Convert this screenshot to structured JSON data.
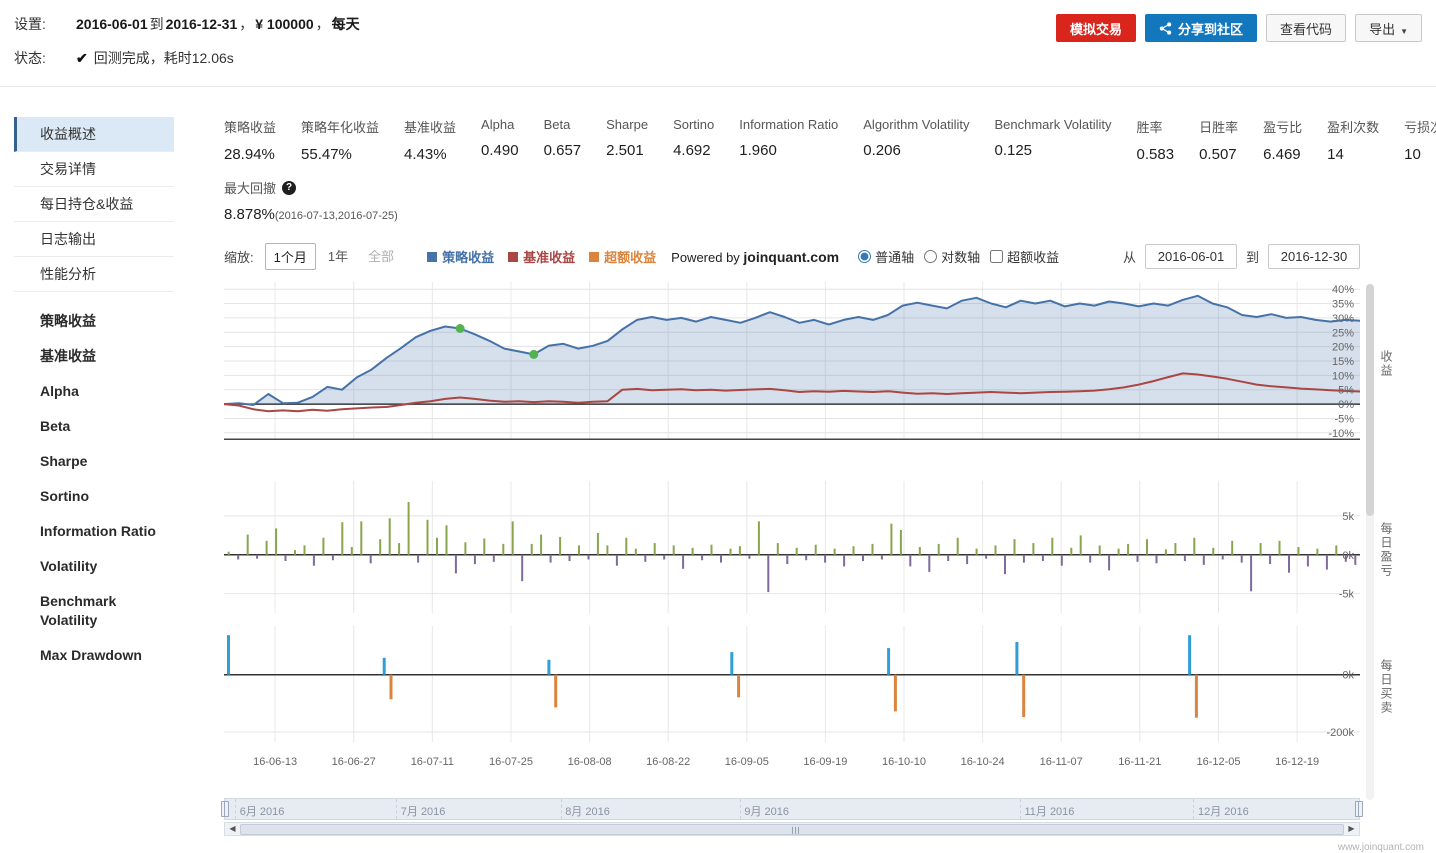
{
  "header": {
    "settings_label": "设置:",
    "settings": {
      "date_from": "2016-06-01",
      "to_word": "到",
      "date_to": "2016-12-31",
      "sep1": "，",
      "capital": "¥ 100000",
      "sep2": "，",
      "frequency": "每天"
    },
    "status_label": "状态:",
    "status_check": "✔",
    "status_text": "回测完成，耗时12.06s",
    "buttons": {
      "simulate": "模拟交易",
      "share": "分享到社区",
      "view_code": "查看代码",
      "export": "导出",
      "export_caret": "▼"
    }
  },
  "sidebar": {
    "nav": [
      {
        "label": "收益概述",
        "active": true
      },
      {
        "label": "交易详情",
        "active": false
      },
      {
        "label": "每日持仓&收益",
        "active": false
      },
      {
        "label": "日志输出",
        "active": false
      },
      {
        "label": "性能分析",
        "active": false
      }
    ],
    "metric_links": [
      "策略收益",
      "基准收益",
      "Alpha",
      "Beta",
      "Sharpe",
      "Sortino",
      "Information Ratio",
      "Volatility",
      "Benchmark Volatility",
      "Max Drawdown"
    ]
  },
  "metrics": [
    {
      "label": "策略收益",
      "value": "28.94%"
    },
    {
      "label": "策略年化收益",
      "value": "55.47%"
    },
    {
      "label": "基准收益",
      "value": "4.43%"
    },
    {
      "label": "Alpha",
      "value": "0.490"
    },
    {
      "label": "Beta",
      "value": "0.657"
    },
    {
      "label": "Sharpe",
      "value": "2.501"
    },
    {
      "label": "Sortino",
      "value": "4.692"
    },
    {
      "label": "Information Ratio",
      "value": "1.960"
    },
    {
      "label": "Algorithm Volatility",
      "value": "0.206"
    },
    {
      "label": "Benchmark Volatility",
      "value": "0.125"
    },
    {
      "label": "胜率",
      "value": "0.583"
    },
    {
      "label": "日胜率",
      "value": "0.507"
    },
    {
      "label": "盈亏比",
      "value": "6.469"
    },
    {
      "label": "盈利次数",
      "value": "14"
    },
    {
      "label": "亏损次数",
      "value": "10"
    }
  ],
  "max_drawdown": {
    "label": "最大回撤",
    "help": "?",
    "value": "8.878%",
    "range": "(2016-07-13,2016-07-25)"
  },
  "controls": {
    "zoom_label": "缩放:",
    "zoom_buttons": [
      {
        "label": "1个月",
        "state": "selected"
      },
      {
        "label": "1年",
        "state": "normal"
      },
      {
        "label": "全部",
        "state": "disabled"
      }
    ],
    "legend": [
      {
        "label": "策略收益",
        "color": "#4572A7"
      },
      {
        "label": "基准收益",
        "color": "#AA4643"
      },
      {
        "label": "超额收益",
        "color": "#DB843D"
      }
    ],
    "powered_prefix": "Powered by ",
    "powered_brand": "joinquant.com",
    "axis_options": [
      {
        "label": "普通轴",
        "checked": true
      },
      {
        "label": "对数轴",
        "checked": false
      }
    ],
    "excess_option": {
      "label": "超额收益",
      "checked": false
    },
    "from_label": "从",
    "from_value": "2016-06-01",
    "to_label": "到",
    "to_value": "2016-12-30"
  },
  "chart_data": [
    {
      "type": "line",
      "name": "returns-chart",
      "ylabel": "收益",
      "ylim": [
        -12.5,
        42.5
      ],
      "axis_line": true,
      "y_ticks": [
        {
          "v": 40,
          "label": "40%"
        },
        {
          "v": 35,
          "label": "35%"
        },
        {
          "v": 30,
          "label": "30%"
        },
        {
          "v": 25,
          "label": "25%"
        },
        {
          "v": 20,
          "label": "20%"
        },
        {
          "v": 15,
          "label": "15%"
        },
        {
          "v": 10,
          "label": "10%"
        },
        {
          "v": 5,
          "label": "5%"
        },
        {
          "v": 0,
          "label": "0%"
        },
        {
          "v": -5,
          "label": "-5%"
        },
        {
          "v": -10,
          "label": "-10%"
        }
      ],
      "series": [
        {
          "name": "策略收益",
          "color": "#4572A7",
          "fill": "rgba(69,114,167,0.22)",
          "values": [
            0,
            0.3,
            -0.3,
            3.5,
            0.3,
            0.5,
            2.5,
            6,
            5,
            9.3,
            12,
            16,
            19.5,
            23.3,
            25.5,
            27,
            26.3,
            24.3,
            22,
            19.3,
            18.3,
            17.3,
            20.3,
            21,
            19.3,
            20.3,
            22,
            26,
            29.3,
            30.3,
            29.3,
            30,
            28.7,
            30.3,
            29.3,
            28.3,
            30,
            32,
            30.3,
            28.3,
            29.3,
            27.7,
            29.3,
            30.3,
            29.3,
            31,
            34.3,
            35.3,
            34.3,
            33.3,
            36,
            37,
            35,
            33.7,
            36,
            35,
            36,
            34,
            35,
            34.3,
            35.7,
            35,
            34,
            35,
            34.3,
            36.3,
            37.7,
            35,
            33.7,
            31,
            30.3,
            31.3,
            30,
            30.3,
            29.3,
            28.7,
            29.3,
            29
          ]
        },
        {
          "name": "基准收益",
          "color": "#AA4643",
          "values": [
            0,
            -0.5,
            -1.8,
            -2.5,
            -2.2,
            -2.5,
            -2,
            -2.3,
            -1.8,
            -1.5,
            -1.2,
            -1,
            -0.3,
            0.5,
            1,
            1.8,
            2.3,
            1.8,
            1.2,
            0.8,
            1,
            0.7,
            1,
            0.8,
            0.5,
            0.8,
            1,
            5,
            5.3,
            4.8,
            5,
            5.2,
            4.8,
            5,
            4.7,
            4.9,
            5.1,
            5.3,
            4.8,
            4.2,
            4.5,
            4.3,
            4.6,
            4.4,
            4.2,
            4.5,
            4,
            3.6,
            3.8,
            3.5,
            3.8,
            4,
            4.2,
            4,
            3.8,
            4,
            4.2,
            4.3,
            4.5,
            4.7,
            5.2,
            5.8,
            6.8,
            8,
            9.4,
            10.7,
            10.3,
            9.6,
            8.8,
            7.8,
            6.8,
            6.2,
            5.8,
            5.4,
            5.1,
            4.8,
            4.6,
            4.4
          ]
        }
      ],
      "markers": [
        {
          "series": 0,
          "index": 16,
          "color": "#53b353",
          "note": "max-drawdown-start"
        },
        {
          "series": 0,
          "index": 21,
          "color": "#53b353",
          "note": "max-drawdown-end"
        }
      ]
    },
    {
      "type": "bar",
      "name": "daily-pnl-chart",
      "ylabel": "每日盈亏",
      "unit": "k",
      "ylim": [
        -7.5,
        9.5
      ],
      "up_color": "#89A54E",
      "down_color": "#80699B",
      "y_ticks": [
        {
          "v": 5,
          "label": "5k"
        },
        {
          "v": 0,
          "label": "0k"
        },
        {
          "v": -5,
          "label": "-5k"
        }
      ],
      "values": [
        0.4,
        -0.6,
        2.6,
        -0.5,
        1.8,
        3.4,
        -0.8,
        0.6,
        1.2,
        -1.4,
        2.2,
        -0.7,
        4.2,
        1.0,
        4.3,
        -1.1,
        2.0,
        4.7,
        1.5,
        6.8,
        -1.0,
        4.5,
        2.2,
        3.8,
        -2.4,
        1.6,
        -1.2,
        2.1,
        -0.9,
        1.4,
        4.3,
        -3.4,
        1.4,
        2.6,
        -1.0,
        2.3,
        -0.8,
        1.2,
        -0.6,
        2.8,
        1.2,
        -1.4,
        2.2,
        0.8,
        -0.9,
        1.5,
        -0.6,
        1.2,
        -1.8,
        0.9,
        -0.7,
        1.3,
        -1.0,
        0.8,
        1.1,
        -0.5,
        4.3,
        -4.8,
        1.5,
        -1.2,
        0.9,
        -0.7,
        1.3,
        -1.0,
        0.8,
        -1.5,
        1.1,
        -0.8,
        1.4,
        -0.6,
        4.0,
        3.2,
        -1.5,
        1.0,
        -2.2,
        1.4,
        -0.8,
        2.2,
        -1.2,
        0.8,
        -0.5,
        1.2,
        -2.5,
        2.0,
        -1.0,
        1.5,
        -0.8,
        2.2,
        -1.4,
        0.9,
        2.5,
        -1.0,
        1.2,
        -2.0,
        0.8,
        1.4,
        -0.9,
        2.0,
        -1.1,
        0.7,
        1.5,
        -0.8,
        2.2,
        -1.3,
        0.9,
        -0.6,
        1.8,
        -1.0,
        -4.7,
        1.5,
        -1.2,
        1.8,
        -2.3,
        1.0,
        -1.5,
        0.8,
        -1.9,
        1.2,
        -0.9,
        -1.3
      ]
    },
    {
      "type": "bar",
      "name": "daily-trades-chart",
      "ylabel": "每日买卖",
      "unit": "k",
      "ylim": [
        -235,
        170
      ],
      "up_color": "#2f9fd6",
      "down_color": "#DB843D",
      "y_ticks": [
        {
          "v": 0,
          "label": "0k"
        },
        {
          "v": -200,
          "label": "-200k"
        }
      ],
      "spikes": [
        {
          "x": 0.004,
          "v": 138
        },
        {
          "x": 0.141,
          "v": 59
        },
        {
          "x": 0.147,
          "v": -86
        },
        {
          "x": 0.286,
          "v": 52
        },
        {
          "x": 0.292,
          "v": -114
        },
        {
          "x": 0.447,
          "v": 79
        },
        {
          "x": 0.453,
          "v": -79
        },
        {
          "x": 0.585,
          "v": 93
        },
        {
          "x": 0.591,
          "v": -128
        },
        {
          "x": 0.698,
          "v": 114
        },
        {
          "x": 0.704,
          "v": -148
        },
        {
          "x": 0.85,
          "v": 138
        },
        {
          "x": 0.856,
          "v": -150
        }
      ]
    }
  ],
  "x_axis": {
    "tick_labels": [
      "16-06-13",
      "16-06-27",
      "16-07-11",
      "16-07-25",
      "16-08-08",
      "16-08-22",
      "16-09-05",
      "16-09-19",
      "16-10-10",
      "16-10-24",
      "16-11-07",
      "16-11-21",
      "16-12-05",
      "16-12-19"
    ]
  },
  "navigator": {
    "months": [
      {
        "label": "6月 2016",
        "x": 0.013
      },
      {
        "label": "7月 2016",
        "x": 0.155
      },
      {
        "label": "8月 2016",
        "x": 0.3
      },
      {
        "label": "9月 2016",
        "x": 0.458
      },
      {
        "label": "11月 2016",
        "x": 0.705
      },
      {
        "label": "12月 2016",
        "x": 0.858
      }
    ]
  },
  "scrollbar": {
    "left_arrow": "◀",
    "right_arrow": "▶"
  },
  "watermark": "www.joinquant.com"
}
